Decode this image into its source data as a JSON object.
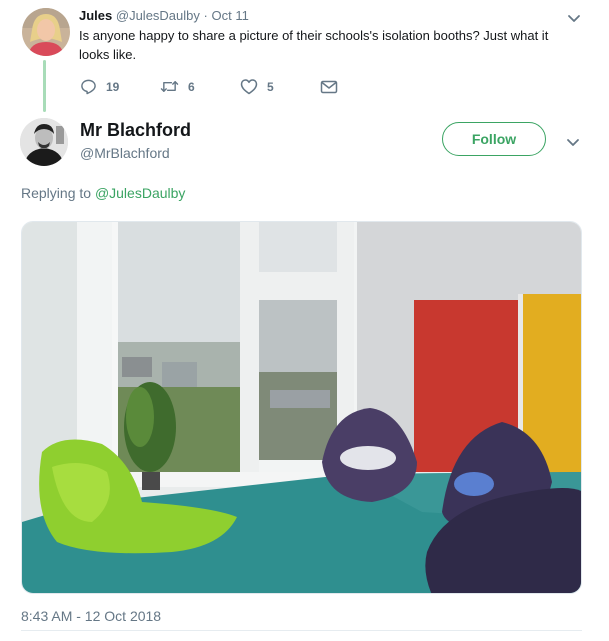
{
  "parent_tweet": {
    "name": "Jules",
    "handle": "@JulesDaulby",
    "separator": "·",
    "date": "Oct 11",
    "text": "Is anyone happy to share a picture of their schools's isolation booths? Just what it looks like.",
    "actions": [
      {
        "icon": "reply-icon",
        "count": "19"
      },
      {
        "icon": "retweet-icon",
        "count": "6"
      },
      {
        "icon": "heart-icon",
        "count": "5"
      },
      {
        "icon": "message-icon",
        "count": ""
      }
    ]
  },
  "main_tweet": {
    "name": "Mr Blachford",
    "handle": "@MrBlachford",
    "follow_label": "Follow",
    "replying_prefix": "Replying to",
    "replying_handle": "@JulesDaulby",
    "image_icon": "photo-isolation-room",
    "timestamp": "8:43 AM - 12 Oct 2018"
  },
  "colors": {
    "accent": "#3ba463",
    "muted": "#657786",
    "text": "#14171a"
  }
}
